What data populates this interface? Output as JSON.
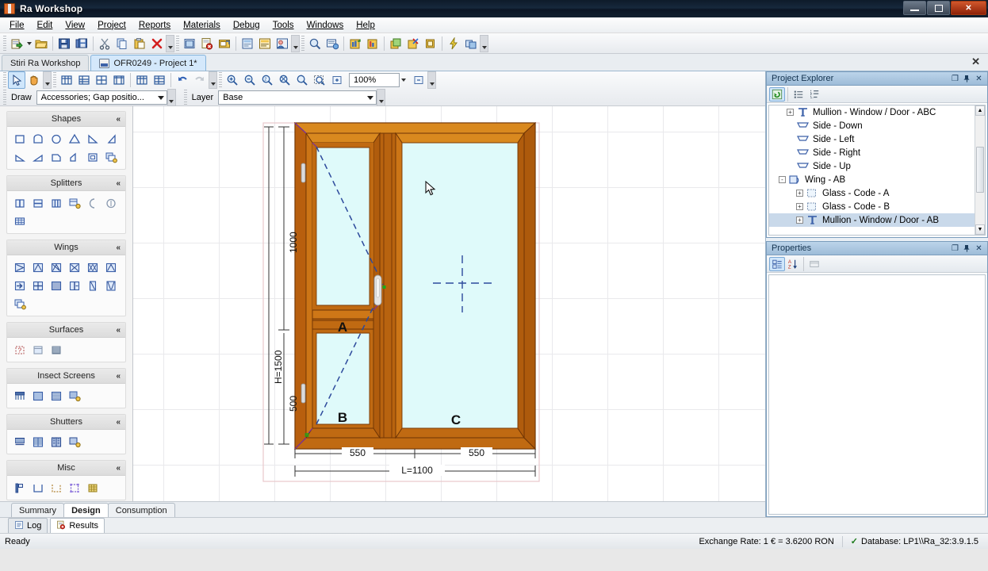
{
  "window": {
    "title": "Ra Workshop",
    "minimize_label": "—",
    "maximize_label": "❐",
    "close_label": "✕"
  },
  "menubar": {
    "items": [
      {
        "label": "File"
      },
      {
        "label": "Edit"
      },
      {
        "label": "View"
      },
      {
        "label": "Project"
      },
      {
        "label": "Reports"
      },
      {
        "label": "Materials"
      },
      {
        "label": "Debug"
      },
      {
        "label": "Tools"
      },
      {
        "label": "Windows"
      },
      {
        "label": "Help"
      }
    ]
  },
  "main_toolbar": {
    "buttons": [
      {
        "name": "new-project-icon"
      },
      {
        "name": "new-project-dropdown-icon"
      },
      {
        "name": "open-folder-icon"
      },
      {
        "name": "save-icon"
      },
      {
        "name": "save-all-icon"
      },
      {
        "name": "cut-icon"
      },
      {
        "name": "copy-icon"
      },
      {
        "name": "paste-icon"
      },
      {
        "name": "delete-icon"
      },
      {
        "name": "window-list-icon"
      },
      {
        "name": "order-cancel-icon"
      },
      {
        "name": "order-properties-icon"
      },
      {
        "name": "offer-icon"
      },
      {
        "name": "invoice-icon"
      },
      {
        "name": "customer-icon"
      },
      {
        "name": "print-preview-icon"
      },
      {
        "name": "print-setup-icon"
      },
      {
        "name": "stock-in-icon"
      },
      {
        "name": "stock-out-icon"
      },
      {
        "name": "production-icon"
      },
      {
        "name": "optimization-icon"
      },
      {
        "name": "package-icon"
      },
      {
        "name": "quick-calc-icon"
      },
      {
        "name": "sync-icon"
      }
    ]
  },
  "doc_tabs": {
    "items": [
      {
        "label": "Stiri Ra Workshop",
        "active": false,
        "has_icon": false
      },
      {
        "label": "OFR0249 - Project 1*",
        "active": true,
        "has_icon": true
      }
    ],
    "close_label": "✕"
  },
  "design_toolbar": {
    "row1_buttons": [
      {
        "name": "select-pointer-icon",
        "active": true
      },
      {
        "name": "pan-hand-icon",
        "active": false
      },
      {
        "name": "align-left-icon"
      },
      {
        "name": "align-top-icon"
      },
      {
        "name": "align-center-icon"
      },
      {
        "name": "align-bottom-icon"
      },
      {
        "name": "distribute-horizontal-icon"
      },
      {
        "name": "distribute-vertical-icon"
      },
      {
        "name": "undo-icon"
      },
      {
        "name": "redo-icon"
      },
      {
        "name": "zoom-in-icon"
      },
      {
        "name": "zoom-out-icon"
      },
      {
        "name": "zoom-100-icon"
      },
      {
        "name": "zoom-fit-icon"
      },
      {
        "name": "zoom-actual-icon"
      },
      {
        "name": "zoom-window-icon"
      },
      {
        "name": "zoom-expand-icon"
      },
      {
        "name": "zoom-collapse-icon"
      }
    ],
    "zoom_value": "100%",
    "draw_label": "Draw",
    "draw_value": "Accessories; Gap positio...",
    "layer_label": "Layer",
    "layer_value": "Base"
  },
  "shapes_panel": {
    "groups": [
      {
        "title": "Shapes",
        "collapse_label": "«",
        "items": [
          {
            "name": "shape-rectangle-icon"
          },
          {
            "name": "shape-arch-top-icon"
          },
          {
            "name": "shape-circle-icon"
          },
          {
            "name": "shape-triangle-icon"
          },
          {
            "name": "shape-slope-right-icon"
          },
          {
            "name": "shape-slope-left-icon"
          },
          {
            "name": "shape-trapezoid-left-icon"
          },
          {
            "name": "shape-trapezoid-right-icon"
          },
          {
            "name": "shape-pentagon-icon"
          },
          {
            "name": "shape-angled-icon"
          },
          {
            "name": "shape-frame-icon"
          },
          {
            "name": "shape-custom-icon"
          }
        ]
      },
      {
        "title": "Splitters",
        "collapse_label": "«",
        "items": [
          {
            "name": "splitter-vertical-icon"
          },
          {
            "name": "splitter-horizontal-icon"
          },
          {
            "name": "splitter-triple-icon"
          },
          {
            "name": "splitter-custom-icon"
          },
          {
            "name": "splitter-arc-icon"
          },
          {
            "name": "splitter-circle-icon"
          },
          {
            "name": "splitter-grid-icon"
          }
        ]
      },
      {
        "title": "Wings",
        "collapse_label": "«",
        "items": [
          {
            "name": "wing-right-open-icon"
          },
          {
            "name": "wing-tilt-icon"
          },
          {
            "name": "wing-tilt-turn-icon"
          },
          {
            "name": "wing-double-icon"
          },
          {
            "name": "wing-double-turn-icon"
          },
          {
            "name": "wing-top-hung-icon"
          },
          {
            "name": "wing-exit-icon"
          },
          {
            "name": "wing-fixed-grid-icon"
          },
          {
            "name": "wing-sliding-icon"
          },
          {
            "name": "wing-split-icon"
          },
          {
            "name": "wing-single-leaf-icon"
          },
          {
            "name": "wing-double-leaf-icon"
          },
          {
            "name": "wing-custom-icon"
          }
        ]
      },
      {
        "title": "Surfaces",
        "collapse_label": "«",
        "items": [
          {
            "name": "surface-unknown-icon"
          },
          {
            "name": "surface-panel-icon"
          },
          {
            "name": "surface-louvre-icon"
          }
        ]
      },
      {
        "title": "Insect Screens",
        "collapse_label": "«",
        "items": [
          {
            "name": "screen-roller-icon"
          },
          {
            "name": "screen-fixed-icon"
          },
          {
            "name": "screen-mesh-icon"
          },
          {
            "name": "screen-custom-icon"
          }
        ]
      },
      {
        "title": "Shutters",
        "collapse_label": "«",
        "items": [
          {
            "name": "shutter-roller-icon"
          },
          {
            "name": "shutter-slat-icon"
          },
          {
            "name": "shutter-panel-icon"
          },
          {
            "name": "shutter-custom-icon"
          }
        ]
      },
      {
        "title": "Misc",
        "collapse_label": "«",
        "items": [
          {
            "name": "misc-handle-icon"
          },
          {
            "name": "misc-sill-icon"
          },
          {
            "name": "misc-dashed-box-icon"
          },
          {
            "name": "misc-selection-icon"
          },
          {
            "name": "misc-mesh-icon"
          }
        ]
      }
    ]
  },
  "drawing": {
    "height_total_label": "H=1500",
    "height_upper_label": "1000",
    "height_lower_label": "500",
    "width_left_label": "550",
    "width_right_label": "550",
    "width_total_label": "L=1100",
    "sash_labels": [
      "A",
      "B",
      "C"
    ],
    "frame_color": "#C06A12",
    "frame_light": "#D4801E",
    "frame_dark": "#7A3A06",
    "glass_color": "#DFFAFA",
    "opening_line_color": "#2D4A9C"
  },
  "bottom_tabs": {
    "items": [
      {
        "label": "Summary",
        "active": false
      },
      {
        "label": "Design",
        "active": true
      },
      {
        "label": "Consumption",
        "active": false
      }
    ]
  },
  "project_explorer": {
    "title": "Project Explorer",
    "float_label": "❐",
    "pin_label": "⚲",
    "close_label": "✕",
    "toolbar": [
      {
        "name": "refresh-icon",
        "active": true
      },
      {
        "name": "list-view-icon",
        "active": false
      },
      {
        "name": "tree-view-icon",
        "active": false
      }
    ],
    "tree": [
      {
        "label": "Mullion - Window / Door - ABC",
        "indent": 1,
        "expander": "+",
        "icon": "mullion-icon",
        "selected": false
      },
      {
        "label": "Side - Down",
        "indent": 1,
        "expander": "",
        "icon": "side-icon",
        "selected": false
      },
      {
        "label": "Side - Left",
        "indent": 1,
        "expander": "",
        "icon": "side-icon",
        "selected": false
      },
      {
        "label": "Side - Right",
        "indent": 1,
        "expander": "",
        "icon": "side-icon",
        "selected": false
      },
      {
        "label": "Side - Up",
        "indent": 1,
        "expander": "",
        "icon": "side-icon",
        "selected": false
      },
      {
        "label": "Wing - AB",
        "indent": 0,
        "expander": "-",
        "icon": "wing-icon",
        "selected": false
      },
      {
        "label": "Glass - Code - A",
        "indent": 2,
        "expander": "+",
        "icon": "glass-icon",
        "selected": false
      },
      {
        "label": "Glass - Code - B",
        "indent": 2,
        "expander": "+",
        "icon": "glass-icon",
        "selected": false
      },
      {
        "label": "Mullion - Window / Door - AB",
        "indent": 2,
        "expander": "+",
        "icon": "mullion-icon",
        "selected": true
      }
    ]
  },
  "properties": {
    "title": "Properties",
    "float_label": "❐",
    "pin_label": "⚲",
    "close_label": "✕",
    "toolbar": [
      {
        "name": "categorized-view-icon",
        "active": true
      },
      {
        "name": "alphabetical-sort-icon",
        "active": false
      },
      {
        "name": "property-pages-icon",
        "active": false
      }
    ]
  },
  "output_tabs": {
    "items": [
      {
        "label": "Log",
        "active": false,
        "icon": "log-icon"
      },
      {
        "label": "Results",
        "active": true,
        "icon": "results-icon"
      }
    ]
  },
  "statusbar": {
    "ready_label": "Ready",
    "exchange_rate": "Exchange Rate: 1 € = 3.6200 RON",
    "database_check": "✓",
    "database": "Database: LP1\\\\Ra_32:3.9.1.5"
  }
}
